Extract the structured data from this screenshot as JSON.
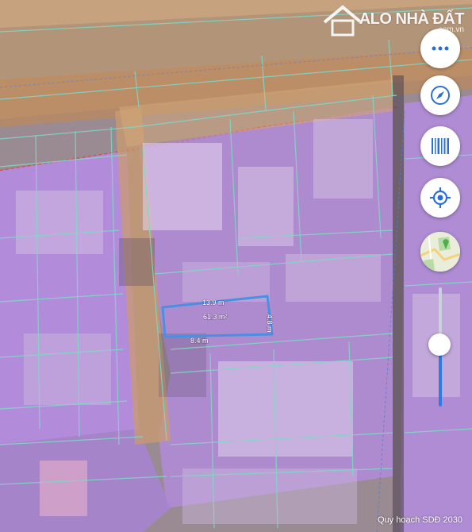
{
  "logo": {
    "name": "ALO NHÀ ĐẤT",
    "domain": ".com.vn"
  },
  "controls": [
    {
      "name": "more",
      "icon": "more-icon"
    },
    {
      "name": "compass",
      "icon": "compass-icon"
    },
    {
      "name": "barcode",
      "icon": "barcode-icon"
    },
    {
      "name": "locate",
      "icon": "crosshair-icon"
    },
    {
      "name": "layer",
      "icon": "map-layer-thumbnail"
    }
  ],
  "zoom": {
    "level": 0.52
  },
  "parcel": {
    "top_edge": "13.9 m",
    "area": "61.3 m²",
    "right_edge": "4.8 m",
    "bottom_edge": "8.4 m",
    "outline_color": "#4a90e2"
  },
  "colors": {
    "residential_overlay": "#b68ce8",
    "road_overlay": "#d9a36c",
    "boundary_line": "#7fd8c6",
    "planning_border": "#e0402c"
  },
  "caption": "Quy hoạch SDĐ 2030"
}
